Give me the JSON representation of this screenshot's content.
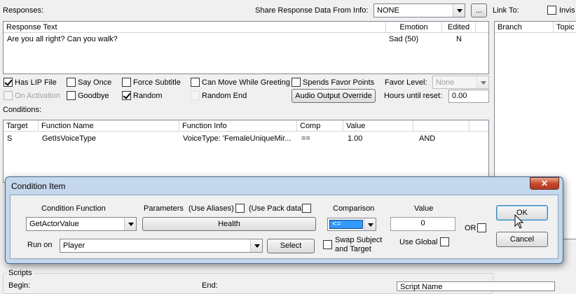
{
  "top": {
    "responses_label": "Responses:",
    "share_label": "Share Response Data From Info:",
    "share_value": "NONE",
    "ellipsis_label": "...",
    "link_to_label": "Link To:",
    "invis_label": "Invis"
  },
  "responses_table": {
    "headers": [
      "Response Text",
      "Emotion",
      "Edited"
    ],
    "rows": [
      [
        "Are you all right? Can you walk?",
        "Sad (50)",
        "N"
      ]
    ]
  },
  "link_table": {
    "headers": [
      "Branch",
      "Topic"
    ]
  },
  "options": {
    "has_lip_file": "Has LIP File",
    "say_once": "Say Once",
    "force_subtitle": "Force Subtitle",
    "can_move": "Can Move While Greeting",
    "spends_favor": "Spends Favor Points",
    "favor_level_label": "Favor Level:",
    "favor_level_value": "None",
    "on_activation": "On Activation",
    "goodbye": "Goodbye",
    "random": "Random",
    "random_end": "Random End",
    "audio_override": "Audio Output Override",
    "hours_label": "Hours until reset:",
    "hours_value": "0.00"
  },
  "conditions": {
    "label": "Conditions:",
    "headers": [
      "Target",
      "Function Name",
      "Function Info",
      "Comp",
      "Value",
      ""
    ],
    "rows": [
      [
        "S",
        "GetIsVoiceType",
        "VoiceType: 'FemaleUniqueMir...",
        "==",
        "1.00",
        "AND"
      ]
    ]
  },
  "dialog": {
    "title": "Condition Item",
    "close_glyph": "✕",
    "condition_function_label": "Condition Function",
    "condition_function_value": "GetActorValue",
    "parameters_label": "Parameters",
    "use_aliases_label": "(Use Aliases)",
    "use_pack_label": "(Use Pack data)",
    "parameter_button": "Health",
    "comparison_label": "Comparison",
    "comparison_value": "<=",
    "value_label": "Value",
    "value_value": "0",
    "or_label": "OR",
    "run_on_label": "Run on",
    "run_on_value": "Player",
    "select_button": "Select",
    "swap_label_1": "Swap Subject",
    "swap_label_2": "and Target",
    "use_global_label": "Use Global",
    "ok_button": "OK",
    "cancel_button": "Cancel"
  },
  "scripts": {
    "label": "Scripts",
    "begin_label": "Begin:",
    "end_label": "End:",
    "script_name_header": "Script Name"
  },
  "colors": {
    "dialog_frame": "#c4d7ec",
    "close_button": "#c7452b",
    "selection": "#3399ff"
  }
}
